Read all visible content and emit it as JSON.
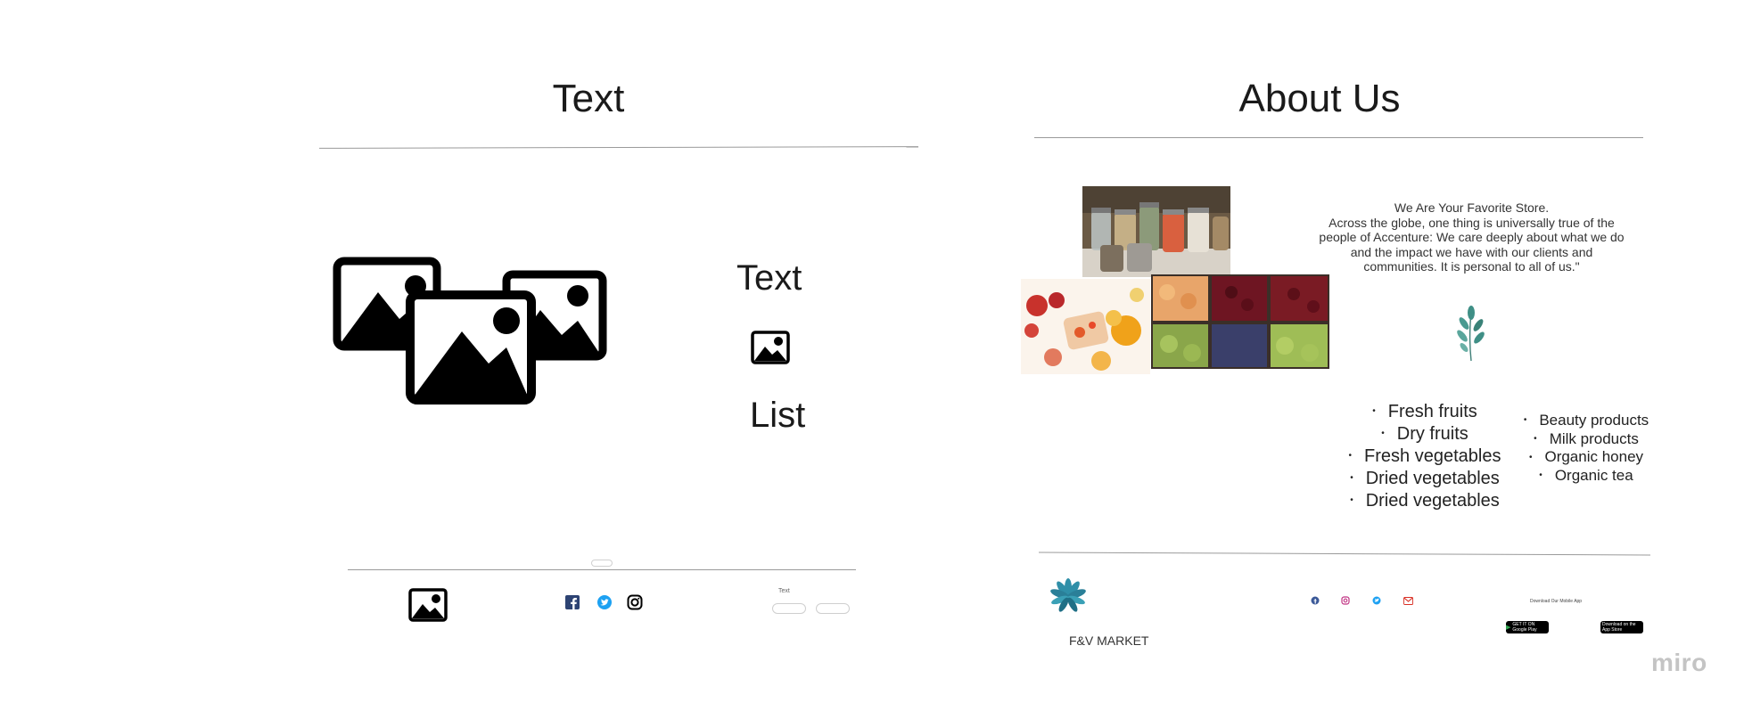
{
  "wireframe": {
    "title": "Text",
    "side_text": "Text",
    "side_list": "List",
    "footer_label": "Text"
  },
  "about": {
    "title": "About Us",
    "paragraph": "We Are Your Favorite Store.\nAcross the globe, one thing is universally true of the people of Accenture: We care deeply about what we do and the impact we have with our clients and communities. It is personal to all of us.\"",
    "list_left": [
      "Fresh fruits",
      "Dry fruits",
      "Fresh vegetables",
      "Dried vegetables",
      "Dried vegetables"
    ],
    "list_right": [
      "Beauty products",
      "Milk products",
      "Organic honey",
      "Organic tea"
    ],
    "brand": "F&V MARKET",
    "download_label": "Download Our Mobile App",
    "google_play": "GET IT ON Google Play",
    "app_store": "Download on the App Store"
  },
  "watermark": "miro",
  "colors": {
    "rule": "#9a9a9a",
    "leaf": "#3f8f86",
    "facebook": "#3b5998",
    "twitter": "#1da1f2",
    "instagram": "#c13584",
    "gmail": "#d93025"
  }
}
